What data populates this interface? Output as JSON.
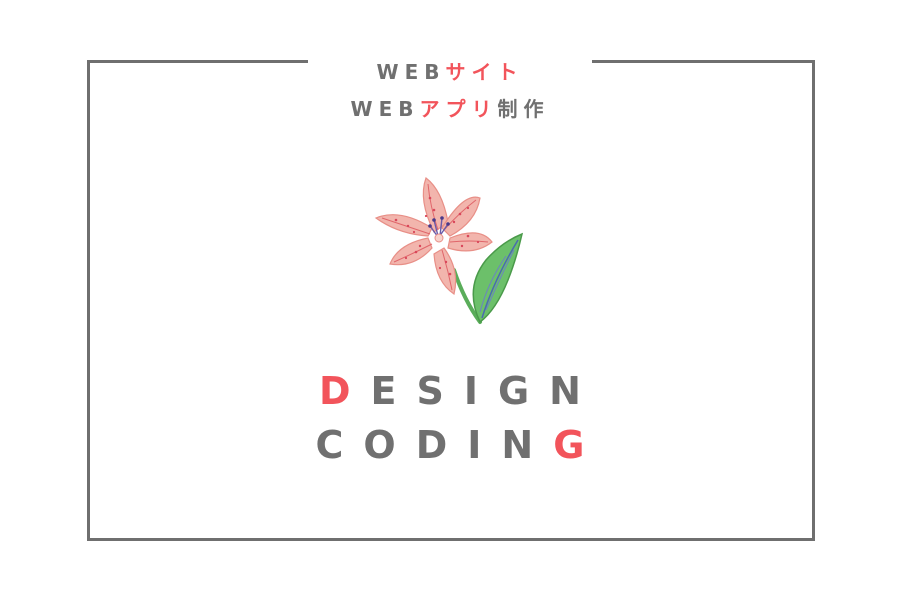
{
  "tagline": {
    "line1": {
      "grey": "WEB",
      "red": "サイト"
    },
    "line2": {
      "grey": "WEB",
      "red": "アプリ",
      "grey_suffix": "制作"
    }
  },
  "illustration": {
    "icon": "lily-flower-icon"
  },
  "headline": {
    "line1": {
      "accent": "D",
      "rest": "ESIGN"
    },
    "line2": {
      "rest": "CODIN",
      "accent": "G"
    }
  },
  "colors": {
    "text_grey": "#707070",
    "accent_red": "#f2545b",
    "frame": "#6f6f6f",
    "background": "#ffffff"
  }
}
